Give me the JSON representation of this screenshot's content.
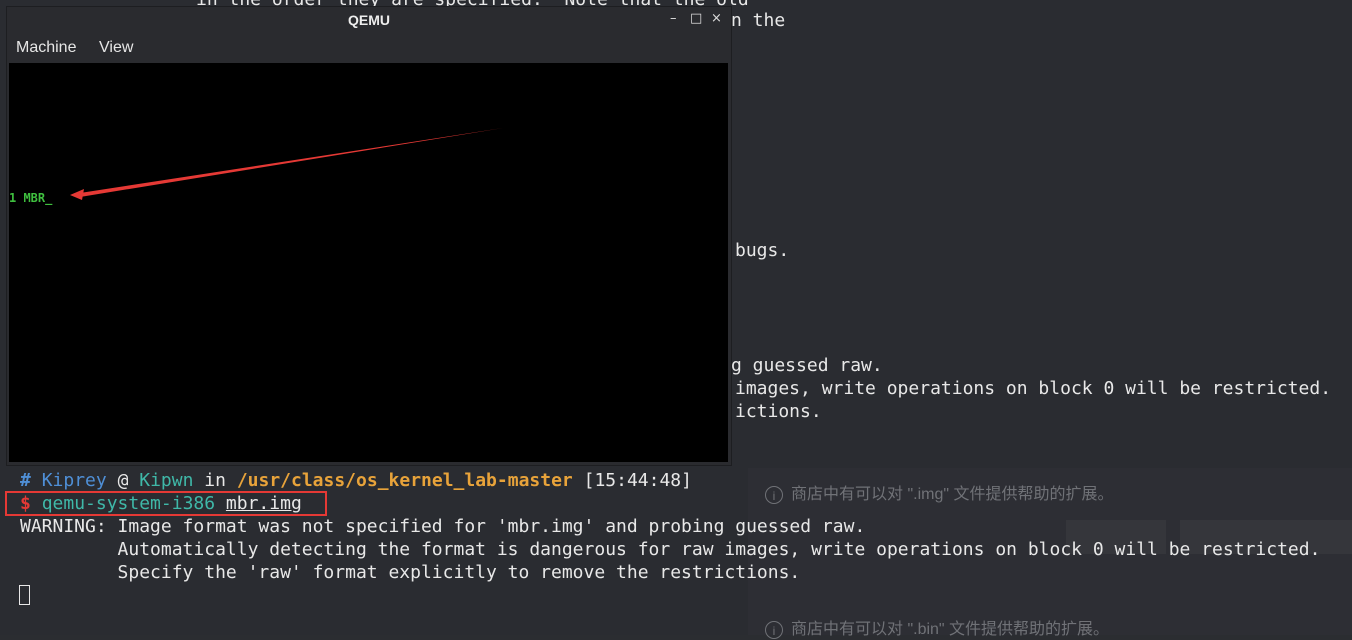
{
  "background_terminal": {
    "lines": [
      "in the order they are specified.  Note that the old",
      "n the",
      "bugs.",
      "g guessed raw.",
      "images, write operations on block 0 will be restricted.",
      "ictions."
    ]
  },
  "notifications": {
    "item1": "商店中有可以对 \".img\" 文件提供帮助的扩展。",
    "item2": "商店中有可以对 \".bin\" 文件提供帮助的扩展。"
  },
  "qemu": {
    "title": "QEMU",
    "controls": {
      "minimize": "–",
      "maximize": "□",
      "close": "×"
    },
    "menu": [
      "Machine",
      "View"
    ],
    "screen_text": "1 MBR_"
  },
  "terminal": {
    "prompt": {
      "hash": "#",
      "user": "Kiprey",
      "at": "@",
      "host": "Kipwn",
      "in": "in",
      "path": "/usr/class/os_kernel_lab-master",
      "time": "[15:44:48]"
    },
    "command": {
      "dollar": "$",
      "program": "qemu-system-i386",
      "arg": "mbr.img"
    },
    "output": [
      "WARNING: Image format was not specified for 'mbr.img' and probing guessed raw.",
      "         Automatically detecting the format is dangerous for raw images, write operations on block 0 will be restricted.",
      "         Specify the 'raw' format explicitly to remove the restrictions."
    ]
  },
  "colors": {
    "terminal_bg": "#2a2c31",
    "prompt_blue": "#4f8fd6",
    "prompt_teal": "#3fb8a8",
    "path_orange": "#e8a33a",
    "dollar_red": "#e53935",
    "vga_green": "#3fbf3f",
    "annotation_red": "#e53935"
  }
}
